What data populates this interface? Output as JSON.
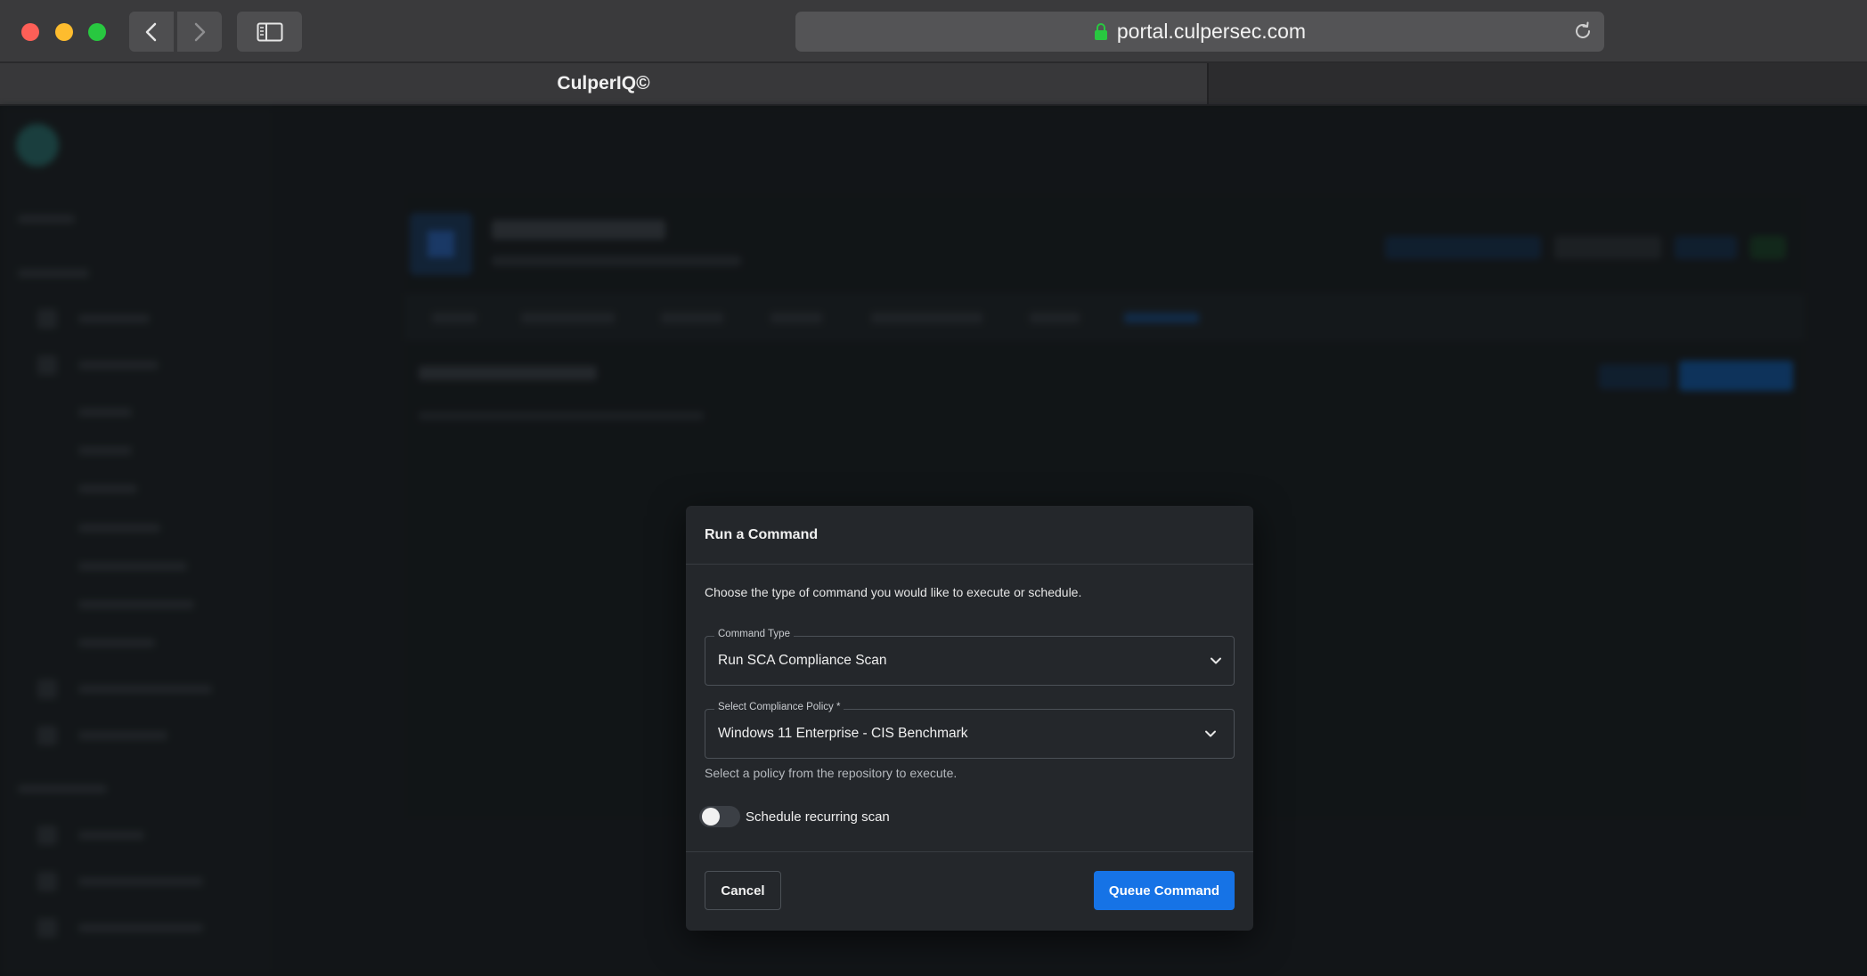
{
  "browser": {
    "url": "portal.culpersec.com",
    "tab_title": "CulperIQ©"
  },
  "modal": {
    "title": "Run a Command",
    "description": "Choose the type of command you would like to execute or schedule.",
    "command_type": {
      "label": "Command Type",
      "value": "Run SCA Compliance Scan"
    },
    "policy": {
      "label": "Select Compliance Policy *",
      "value": "Windows 11 Enterprise - CIS Benchmark",
      "helper": "Select a policy from the repository to execute."
    },
    "schedule_toggle": {
      "label": "Schedule recurring scan",
      "enabled": false
    },
    "cancel_label": "Cancel",
    "submit_label": "Queue Command"
  },
  "colors": {
    "primary": "#1673e6",
    "modal_bg": "#24272b",
    "page_bg": "#1a1c1f"
  }
}
